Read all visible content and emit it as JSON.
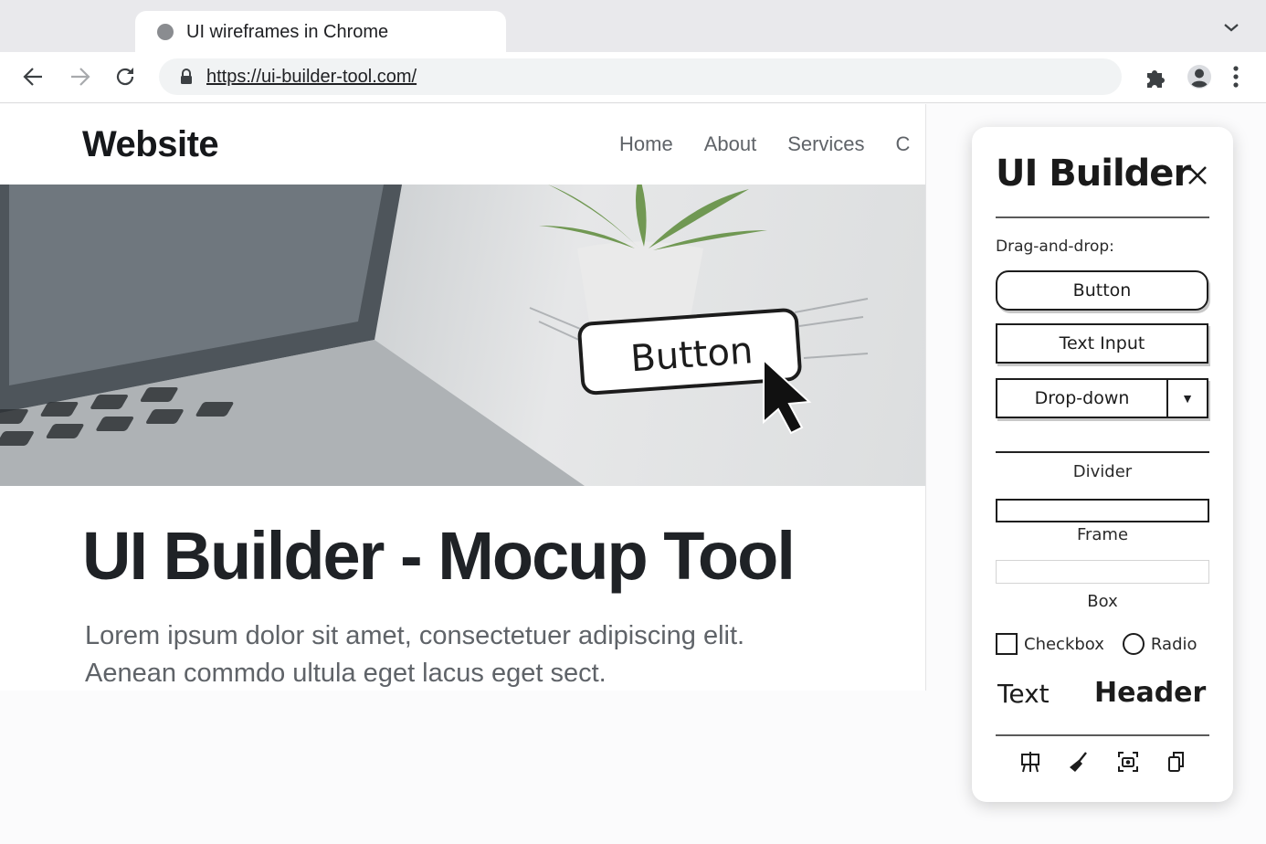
{
  "browser": {
    "tab_title": "UI wireframes in Chrome",
    "url": "https://ui-builder-tool.com/",
    "icons": [
      "back-icon",
      "forward-icon",
      "reload-icon",
      "lock-icon",
      "extensions-icon",
      "profile-icon",
      "menu-icon",
      "tab-dropdown-icon"
    ]
  },
  "site": {
    "logo": "Website",
    "nav": [
      "Home",
      "About",
      "Services",
      "C"
    ],
    "hero_button_label": "Button",
    "title": "UI Builder - Mocup Tool",
    "lorem_line1": "Lorem ipsum dolor sit amet, consectetuer adipiscing elit.",
    "lorem_line2": "Aenean commdo ultula eget lacus eget sect."
  },
  "panel": {
    "title": "UI Builder",
    "section_label": "Drag-and-drop:",
    "button": "Button",
    "text_input": "Text Input",
    "dropdown": "Drop-down",
    "dropdown_arrow": "▼",
    "divider": "Divider",
    "frame": "Frame",
    "box": "Box",
    "checkbox": "Checkbox",
    "radio": "Radio",
    "text": "Text",
    "header": "Header",
    "tools": [
      "easel-icon",
      "broom-icon",
      "screenshot-icon",
      "copy-icon"
    ]
  }
}
